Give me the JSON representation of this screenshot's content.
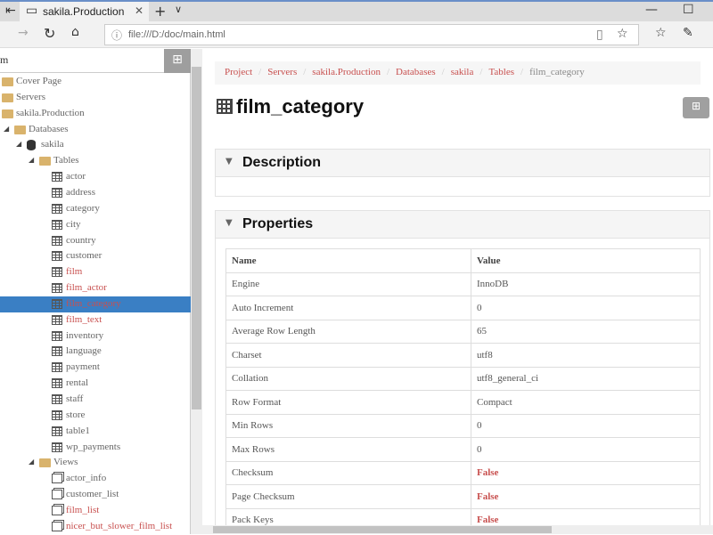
{
  "browser": {
    "tab_title": "sakila.Production",
    "url": "file:///D:/doc/main.html"
  },
  "sidebar": {
    "search_value": "m",
    "items": [
      {
        "label": "Cover Page",
        "type": "folder",
        "level": 0
      },
      {
        "label": "Servers",
        "type": "folder",
        "level": 0
      },
      {
        "label": "sakila.Production",
        "type": "folder",
        "level": 0
      },
      {
        "label": "Databases",
        "type": "folder",
        "level": 1,
        "expanded": true
      },
      {
        "label": "sakila",
        "type": "db",
        "level": 2,
        "expanded": true
      },
      {
        "label": "Tables",
        "type": "folder",
        "level": 3,
        "expanded": true
      },
      {
        "label": "actor",
        "type": "table",
        "level": 4
      },
      {
        "label": "address",
        "type": "table",
        "level": 4
      },
      {
        "label": "category",
        "type": "table",
        "level": 4
      },
      {
        "label": "city",
        "type": "table",
        "level": 4
      },
      {
        "label": "country",
        "type": "table",
        "level": 4
      },
      {
        "label": "customer",
        "type": "table",
        "level": 4
      },
      {
        "label": "film",
        "type": "table",
        "level": 4,
        "highlight": true
      },
      {
        "label": "film_actor",
        "type": "table",
        "level": 4,
        "highlight": true
      },
      {
        "label": "film_category",
        "type": "table",
        "level": 4,
        "highlight": true,
        "selected": true
      },
      {
        "label": "film_text",
        "type": "table",
        "level": 4,
        "highlight": true
      },
      {
        "label": "inventory",
        "type": "table",
        "level": 4
      },
      {
        "label": "language",
        "type": "table",
        "level": 4
      },
      {
        "label": "payment",
        "type": "table",
        "level": 4
      },
      {
        "label": "rental",
        "type": "table",
        "level": 4
      },
      {
        "label": "staff",
        "type": "table",
        "level": 4
      },
      {
        "label": "store",
        "type": "table",
        "level": 4
      },
      {
        "label": "table1",
        "type": "table",
        "level": 4
      },
      {
        "label": "wp_payments",
        "type": "table",
        "level": 4
      },
      {
        "label": "Views",
        "type": "folder",
        "level": 3,
        "expanded": true
      },
      {
        "label": "actor_info",
        "type": "view",
        "level": 4
      },
      {
        "label": "customer_list",
        "type": "view",
        "level": 4
      },
      {
        "label": "film_list",
        "type": "view",
        "level": 4,
        "highlight": true
      },
      {
        "label": "nicer_but_slower_film_list",
        "type": "view",
        "level": 4,
        "highlight": true
      }
    ]
  },
  "breadcrumb": [
    "Project",
    "Servers",
    "sakila.Production",
    "Databases",
    "sakila",
    "Tables"
  ],
  "breadcrumb_current": "film_category",
  "page_title": "film_category",
  "description": {
    "title": "Description"
  },
  "properties": {
    "title": "Properties",
    "headers": [
      "Name",
      "Value"
    ],
    "rows": [
      [
        "Engine",
        "InnoDB"
      ],
      [
        "Auto Increment",
        "0"
      ],
      [
        "Average Row Length",
        "65"
      ],
      [
        "Charset",
        "utf8"
      ],
      [
        "Collation",
        "utf8_general_ci"
      ],
      [
        "Row Format",
        "Compact"
      ],
      [
        "Min Rows",
        "0"
      ],
      [
        "Max Rows",
        "0"
      ],
      [
        "Checksum",
        "False"
      ],
      [
        "Page Checksum",
        "False"
      ],
      [
        "Pack Keys",
        "False"
      ]
    ]
  },
  "colors": {
    "accent": "#c8504f",
    "selection": "#3a7fc4"
  }
}
